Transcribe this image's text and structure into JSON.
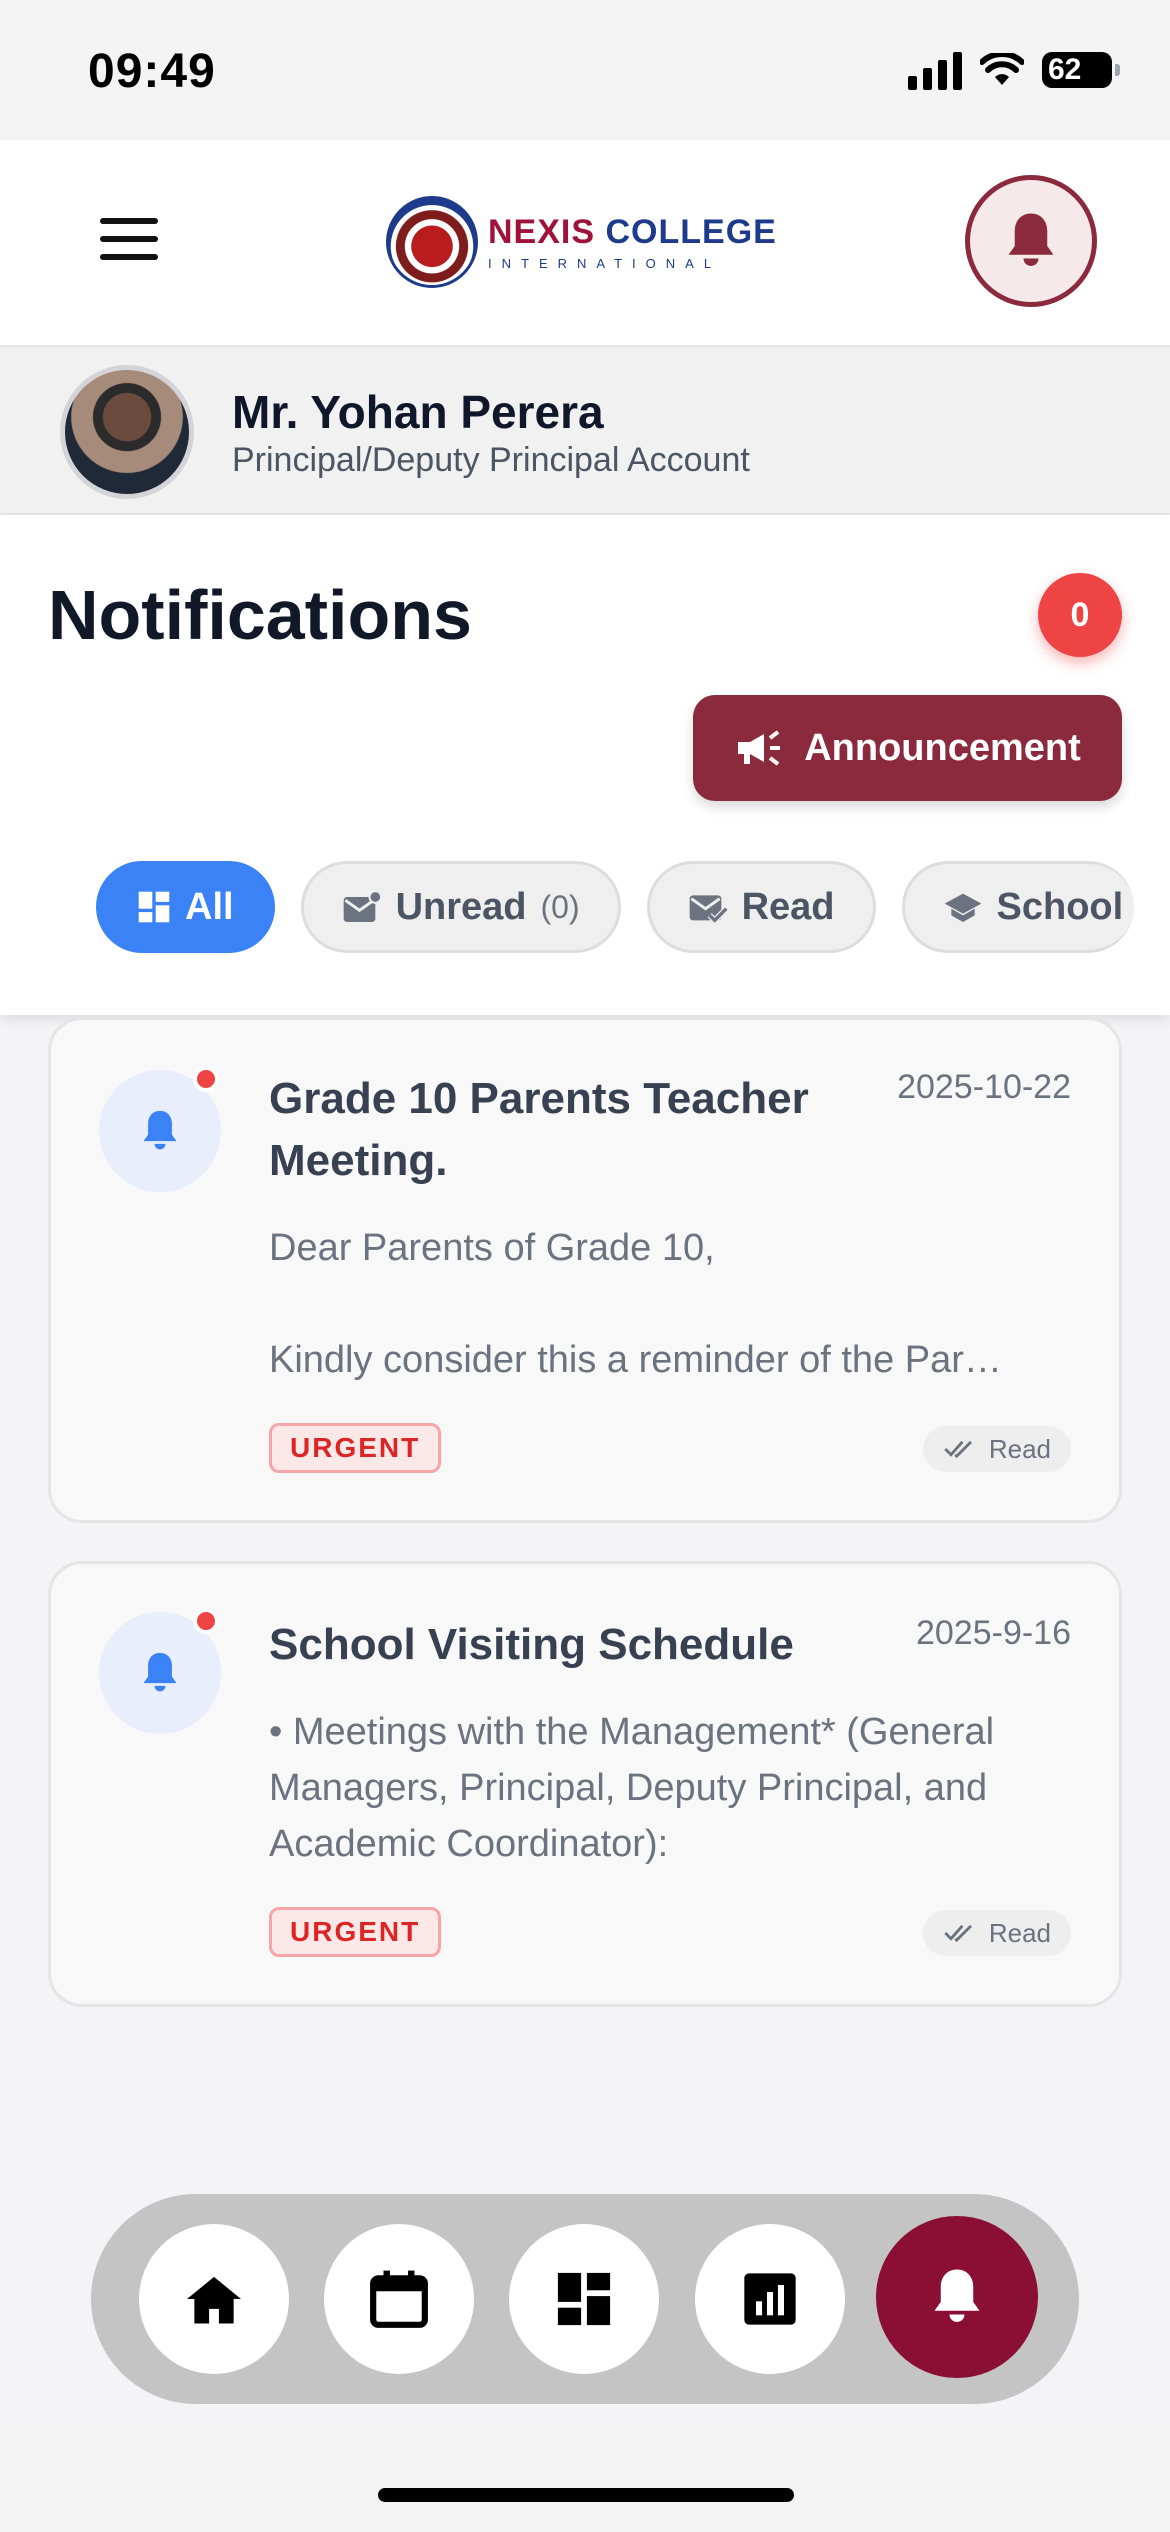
{
  "status_bar": {
    "time": "09:49",
    "battery": "62"
  },
  "header": {
    "logo_name": "NEXIS COLLEGE",
    "logo_sub": "INTERNATIONAL"
  },
  "user": {
    "name": "Mr. Yohan Perera",
    "role": "Principal/Deputy Principal Account"
  },
  "notifications": {
    "title": "Notifications",
    "count": "0",
    "announcement_label": "Announcement",
    "filters": [
      {
        "label": "All",
        "active": true
      },
      {
        "label": "Unread",
        "count": "(0)"
      },
      {
        "label": "Read"
      },
      {
        "label": "School"
      }
    ],
    "items": [
      {
        "title": "Grade 10 Parents Teacher Meeting.",
        "date": "2025-10-22",
        "body": "Dear Parents of Grade 10,\n\nKindly consider this a reminder of the Par…",
        "priority": "URGENT",
        "status": "Read"
      },
      {
        "title": "School Visiting Schedule",
        "date": "2025-9-16",
        "body": "• Meetings with the Management* (General Managers, Principal, Deputy Principal, and Academic Coordinator):",
        "priority": "URGENT",
        "status": "Read"
      }
    ]
  },
  "bottom_nav": [
    "home-icon",
    "calendar-icon",
    "dashboard-icon",
    "analytics-icon",
    "bell-icon"
  ],
  "colors": {
    "brand": "#8b2a3c",
    "accent": "#3b82f6",
    "urgent": "#ef4444"
  }
}
